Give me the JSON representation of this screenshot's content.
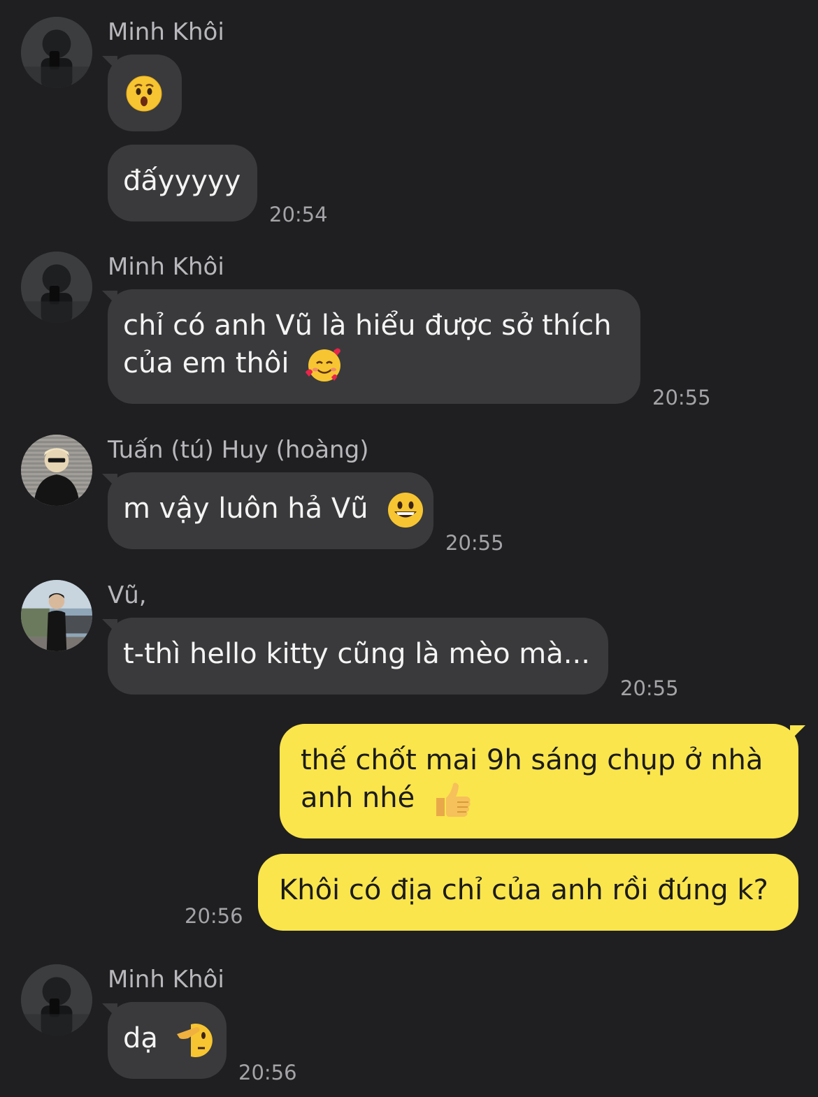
{
  "messages": [
    {
      "sender": "Minh Khôi",
      "bubbles": [
        {
          "emoji": "astonished-face"
        },
        {
          "text": "đấyyyyy"
        }
      ],
      "time": "20:54"
    },
    {
      "sender": "Minh Khôi",
      "line1": "chỉ có anh Vũ là hiểu được sở thích",
      "line2": "của em thôi",
      "emoji": "smiling-face-with-hearts",
      "time": "20:55"
    },
    {
      "sender": "Tuấn (tú) Huy (hoàng)",
      "text": "m vậy luôn hả Vũ",
      "emoji": "grinning-face",
      "time": "20:55"
    },
    {
      "sender": "Vũ,",
      "text": "t-thì hello kitty cũng là mèo mà...",
      "time": "20:55"
    },
    {
      "outgoing": true,
      "line1": "thế chốt mai 9h sáng chụp ở nhà",
      "line2": "anh nhé",
      "emoji": "thumbs-up"
    },
    {
      "outgoing": true,
      "text": "Khôi có địa chỉ của anh rồi đúng k?",
      "time": "20:56"
    },
    {
      "sender": "Minh Khôi",
      "text": "dạ",
      "emoji": "saluting-face",
      "time": "20:56"
    }
  ],
  "colors": {
    "background": "#1f1f21",
    "incoming_bubble": "#3a3a3c",
    "outgoing_bubble": "#fae54c"
  }
}
